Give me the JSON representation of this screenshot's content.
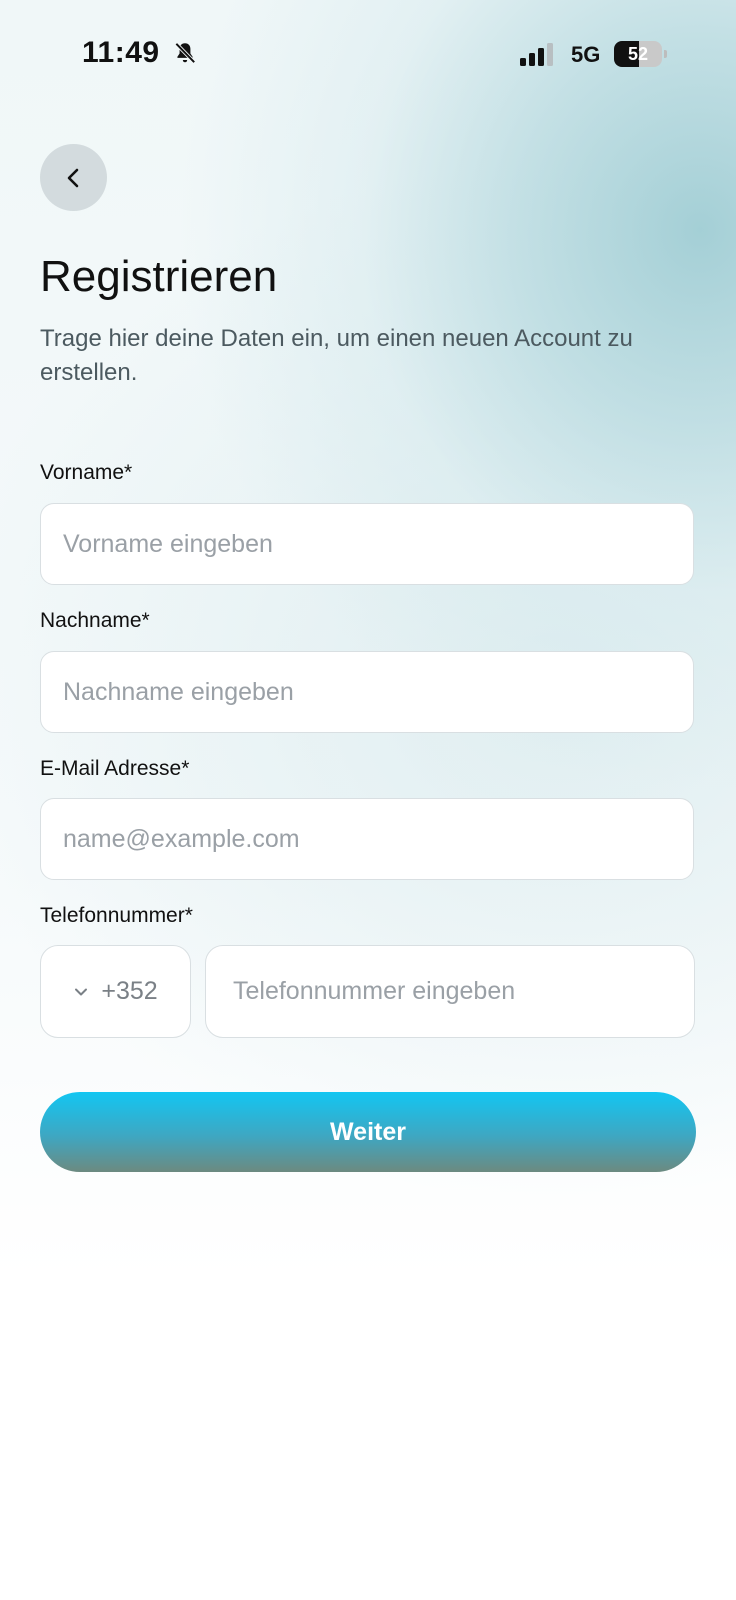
{
  "status_bar": {
    "time": "11:49",
    "network": "5G",
    "battery": "52"
  },
  "header": {
    "title": "Registrieren",
    "subtitle": "Trage hier deine Daten ein, um einen neuen Account zu erstellen."
  },
  "form": {
    "first_name": {
      "label": "Vorname*",
      "placeholder": "Vorname eingeben",
      "value": ""
    },
    "last_name": {
      "label": "Nachname*",
      "placeholder": "Nachname eingeben",
      "value": ""
    },
    "email": {
      "label": "E-Mail Adresse*",
      "placeholder": "name@example.com",
      "value": ""
    },
    "phone": {
      "label": "Telefonnummer*",
      "country_code": "+352",
      "placeholder": "Telefonnummer eingeben",
      "value": ""
    },
    "submit_label": "Weiter"
  },
  "colors": {
    "button_top": "#12c6f2",
    "button_bottom": "#6c8a80",
    "text_primary": "#111111",
    "placeholder": "#9aa0a6"
  },
  "icons": {
    "back": "chevron-left-icon",
    "silent": "bell-slash-icon",
    "signal": "cellular-signal-icon",
    "battery": "battery-icon",
    "country_dropdown": "chevron-down-icon"
  }
}
